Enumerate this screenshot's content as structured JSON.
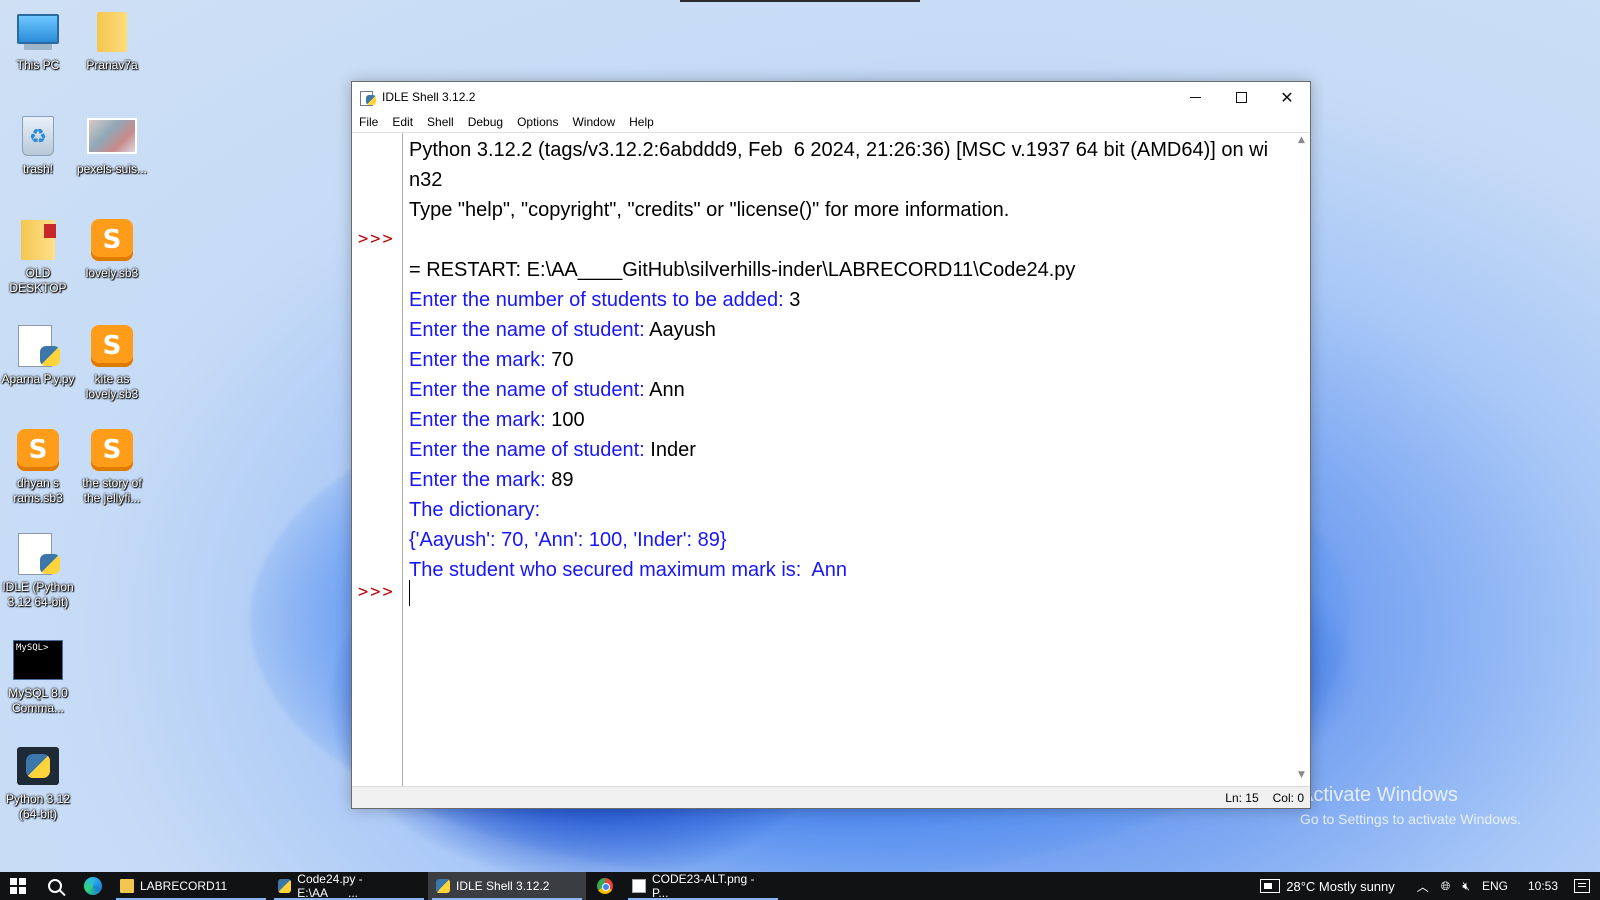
{
  "desktop": {
    "icons": [
      {
        "label": "This PC",
        "icon": "monitor-icon"
      },
      {
        "label": "Pranav7a",
        "icon": "folder-icon"
      },
      {
        "label": "trash!",
        "icon": "recycle-bin-icon"
      },
      {
        "label": "pexels-suis...",
        "icon": "image-file-icon"
      },
      {
        "label": "OLD DESKTOP",
        "icon": "folder-icon"
      },
      {
        "label": "lovely.sb3",
        "icon": "scratch-file-icon"
      },
      {
        "label": "Aparna P.y.py",
        "icon": "python-file-icon"
      },
      {
        "label": "kite as lovely.sb3",
        "icon": "scratch-file-icon"
      },
      {
        "label": "dhyan s rams.sb3",
        "icon": "scratch-file-icon"
      },
      {
        "label": "the story of the jellyfi...",
        "icon": "scratch-file-icon"
      },
      {
        "label": "IDLE (Python 3.12 64-bit)",
        "icon": "python-idle-icon"
      },
      {
        "label": "MySQL 8.0 Comma...",
        "icon": "mysql-terminal-icon"
      },
      {
        "label": "Python 3.12 (64-bit)",
        "icon": "python-app-icon"
      }
    ],
    "activate": {
      "title": "Activate Windows",
      "subtitle": "Go to Settings to activate Windows."
    }
  },
  "window": {
    "title": "IDLE Shell 3.12.2",
    "menu": [
      "File",
      "Edit",
      "Shell",
      "Debug",
      "Options",
      "Window",
      "Help"
    ],
    "prompt": ">>>",
    "lines": {
      "l1": "Python 3.12.2 (tags/v3.12.2:6abddd9, Feb  6 2024, 21:26:36) [MSC v.1937 64 bit (AMD64)] on wi",
      "l2": "n32",
      "l3": "Type \"help\", \"copyright\", \"credits\" or \"license()\" for more information.",
      "l4": "= RESTART: E:\\AA____GitHub\\silverhills-inder\\LABRECORD11\\Code24.py",
      "l5a": "Enter the number of students to be added: ",
      "l5b": "3",
      "l6a": "Enter the name of student: ",
      "l6b": "Aayush",
      "l7a": "Enter the mark: ",
      "l7b": "70",
      "l8a": "Enter the name of student: ",
      "l8b": "Ann",
      "l9a": "Enter the mark: ",
      "l9b": "100",
      "l10a": "Enter the name of student: ",
      "l10b": "Inder",
      "l11a": "Enter the mark: ",
      "l11b": "89",
      "l12": "The dictionary:",
      "l13": "{'Aayush': 70, 'Ann': 100, 'Inder': 89}",
      "l14": "The student who secured maximum mark is:  Ann"
    },
    "status": {
      "ln": "Ln: 15",
      "col": "Col: 0"
    },
    "colors": {
      "prompt": "#c00000",
      "output": "#1616ff",
      "input": "#000000"
    }
  },
  "taskbar": {
    "tasks": [
      {
        "label": "LABRECORD11",
        "icon": "folder-icon"
      },
      {
        "label": "Code24.py - E:\\AA___...",
        "icon": "python-file-icon"
      },
      {
        "label": "IDLE Shell 3.12.2",
        "icon": "python-idle-icon"
      },
      {
        "label": "CODE23-ALT.png - P...",
        "icon": "image-viewer-icon"
      }
    ],
    "weather": "28°C  Mostly sunny",
    "lang": "ENG",
    "time": "10:53"
  }
}
